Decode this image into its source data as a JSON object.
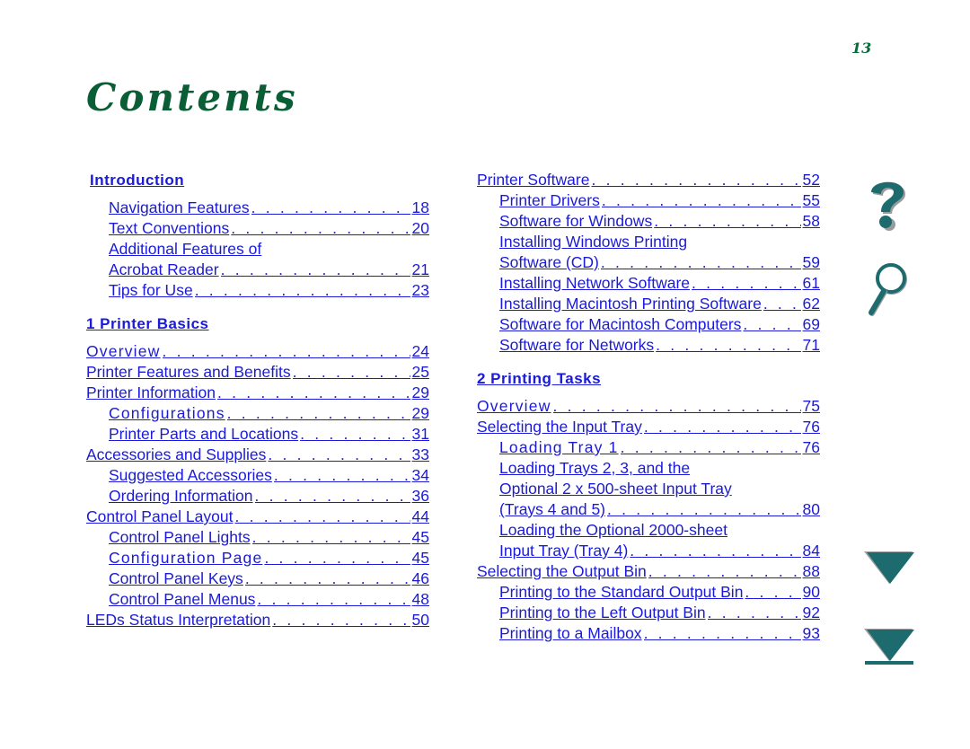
{
  "page": {
    "number": "13",
    "title": "Contents"
  },
  "colors": {
    "title": "#0a5e36",
    "link": "#1a1ad8",
    "icon": "#1d6b6e"
  },
  "left_column": {
    "sections": [
      {
        "heading": "Introduction",
        "entries": [
          {
            "label": "Navigation Features",
            "page": "18",
            "indent": true
          },
          {
            "label": "Text Conventions",
            "page": "20",
            "indent": true
          },
          {
            "label": "Additional Features of",
            "page": "",
            "indent": true
          },
          {
            "label": "Acrobat Reader",
            "page": "21",
            "indent": true
          },
          {
            "label": "Tips for Use",
            "page": "23",
            "indent": true
          }
        ]
      },
      {
        "heading": "1 Printer Basics",
        "entries": [
          {
            "label": "Overview",
            "page": "24",
            "indent": false
          },
          {
            "label": "Printer Features and Benefits",
            "page": "25",
            "indent": false
          },
          {
            "label": "Printer Information",
            "page": "29",
            "indent": false
          },
          {
            "label": "Configurations",
            "page": "29",
            "indent": true
          },
          {
            "label": "Printer Parts and Locations",
            "page": "31",
            "indent": true
          },
          {
            "label": "Accessories and Supplies",
            "page": "33",
            "indent": false
          },
          {
            "label": "Suggested Accessories",
            "page": "34",
            "indent": true
          },
          {
            "label": "Ordering Information",
            "page": "36",
            "indent": true
          },
          {
            "label": "Control Panel Layout",
            "page": "44",
            "indent": false
          },
          {
            "label": "Control Panel Lights",
            "page": "45",
            "indent": true
          },
          {
            "label": "Configuration Page",
            "page": "45",
            "indent": true
          },
          {
            "label": "Control Panel Keys",
            "page": "46",
            "indent": true
          },
          {
            "label": "Control Panel Menus",
            "page": "48",
            "indent": true
          },
          {
            "label": "LEDs Status Interpretation",
            "page": "50",
            "indent": false
          }
        ]
      }
    ]
  },
  "right_column": {
    "top_entries": [
      {
        "label": "Printer Software",
        "page": "52",
        "indent": false
      },
      {
        "label": "Printer Drivers",
        "page": "55",
        "indent": true
      },
      {
        "label": "Software for Windows",
        "page": "58",
        "indent": true
      },
      {
        "label": "Installing Windows Printing",
        "page": "",
        "indent": true
      },
      {
        "label": "Software (CD)",
        "page": "59",
        "indent": true
      },
      {
        "label": "Installing Network Software",
        "page": "61",
        "indent": true
      },
      {
        "label": "Installing Macintosh Printing Software",
        "page": "62",
        "indent": true
      },
      {
        "label": "Software for Macintosh Computers",
        "page": "69",
        "indent": true
      },
      {
        "label": "Software for Networks",
        "page": "71",
        "indent": true
      }
    ],
    "sections": [
      {
        "heading": "2  Printing Tasks",
        "entries": [
          {
            "label": "Overview",
            "page": "75",
            "indent": false
          },
          {
            "label": "Selecting the Input Tray",
            "page": "76",
            "indent": false
          },
          {
            "label": "Loading Tray 1",
            "page": "76",
            "indent": true
          },
          {
            "label": "Loading Trays 2, 3, and the",
            "page": "",
            "indent": true
          },
          {
            "label": "Optional 2 x 500-sheet Input Tray",
            "page": "",
            "indent": true
          },
          {
            "label": "(Trays 4 and 5)",
            "page": "80",
            "indent": true
          },
          {
            "label": "Loading the Optional 2000-sheet",
            "page": "",
            "indent": true
          },
          {
            "label": "Input Tray (Tray 4)",
            "page": "84",
            "indent": true
          },
          {
            "label": "Selecting the Output Bin",
            "page": "88",
            "indent": false
          },
          {
            "label": "Printing to the Standard Output Bin",
            "page": "90",
            "indent": true
          },
          {
            "label": "Printing to the Left Output Bin",
            "page": "92",
            "indent": true
          },
          {
            "label": "Printing to a Mailbox",
            "page": "93",
            "indent": true
          }
        ]
      }
    ]
  },
  "nav_icons": [
    {
      "name": "help-icon",
      "label": "Help"
    },
    {
      "name": "search-icon",
      "label": "Search"
    },
    {
      "name": "next-page-icon",
      "label": "Next page"
    },
    {
      "name": "last-page-icon",
      "label": "Last page"
    }
  ]
}
